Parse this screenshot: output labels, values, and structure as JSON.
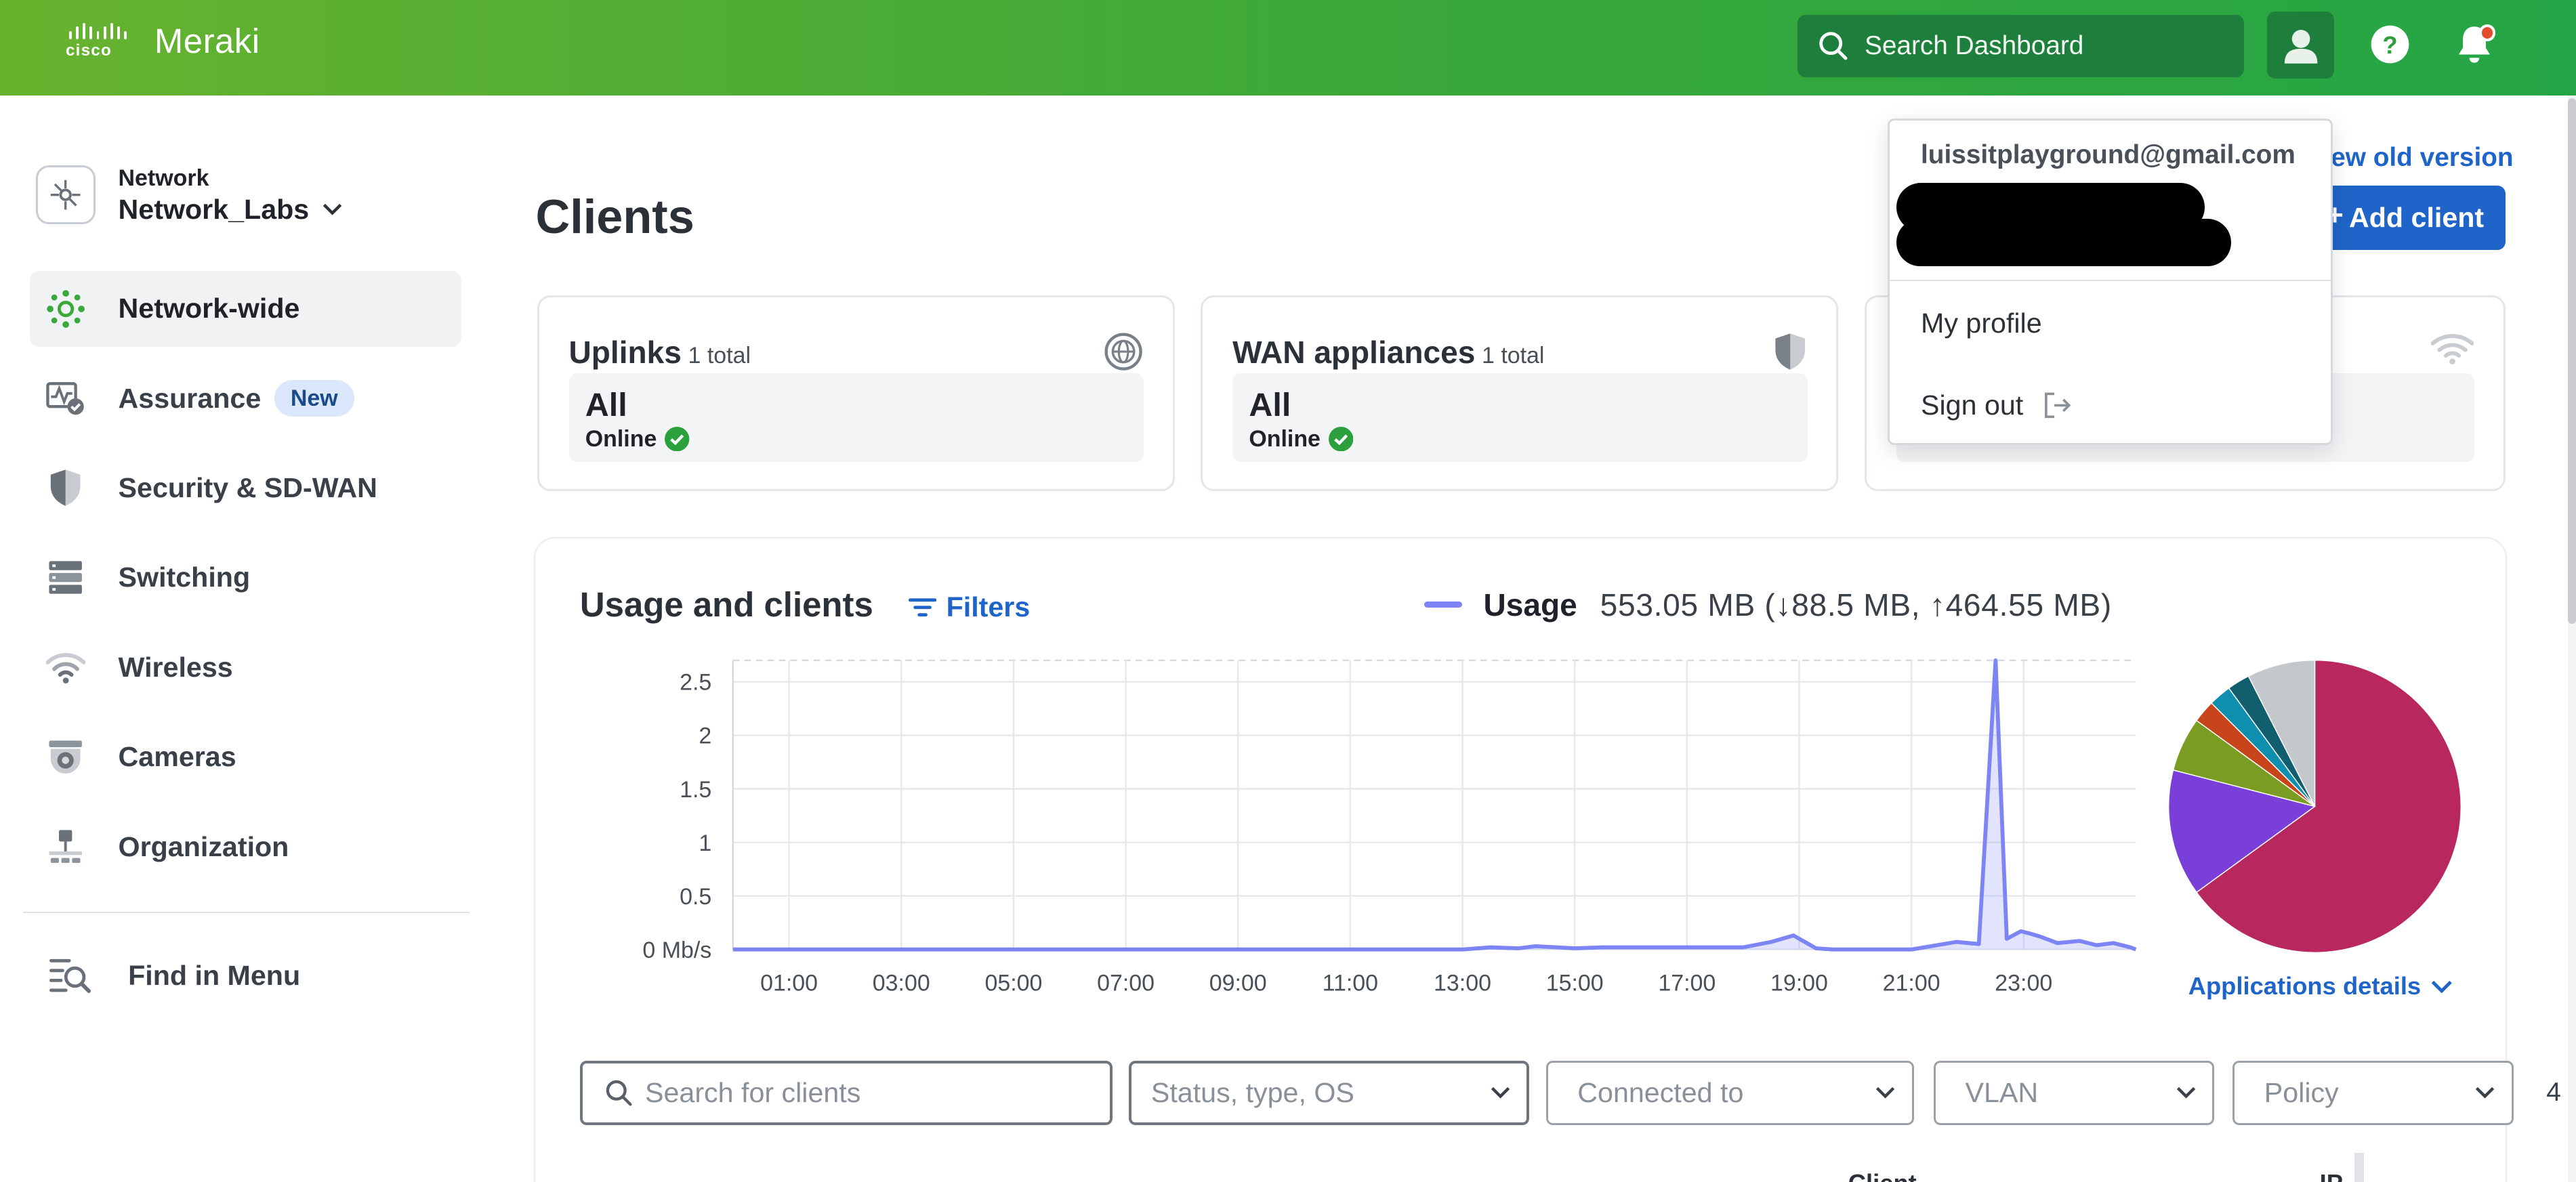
{
  "header": {
    "brand_small": "cisco",
    "brand": "Meraki",
    "search_placeholder": "Search Dashboard",
    "icons": [
      "search-icon",
      "user-icon",
      "help-icon",
      "bell-icon"
    ],
    "colors": {
      "bar_left": "#67b32e",
      "bar_right": "#24a545",
      "search_bg": "#1e7e3b",
      "notification_dot": "#e24d2e"
    }
  },
  "network": {
    "label": "Network",
    "name": "Network_Labs"
  },
  "sidebar": {
    "items": [
      {
        "label": "Network-wide",
        "icon": "network-wide-icon",
        "active": true
      },
      {
        "label": "Assurance",
        "icon": "assurance-icon",
        "badge": "New"
      },
      {
        "label": "Security & SD-WAN",
        "icon": "shield-icon"
      },
      {
        "label": "Switching",
        "icon": "switch-icon"
      },
      {
        "label": "Wireless",
        "icon": "wifi-icon"
      },
      {
        "label": "Cameras",
        "icon": "camera-icon"
      },
      {
        "label": "Organization",
        "icon": "organization-icon"
      }
    ],
    "find_menu": "Find in Menu"
  },
  "page": {
    "title": "Clients",
    "view_old": "View old version",
    "add_client": "Add client"
  },
  "cards": [
    {
      "title": "Uplinks",
      "count": "1 total",
      "value": "All",
      "status": "Online",
      "icon": "globe-icon"
    },
    {
      "title": "WAN appliances",
      "count": "1 total",
      "value": "All",
      "status": "Online",
      "icon": "shield-icon"
    },
    {
      "title": "",
      "count": "",
      "value": "",
      "status": "",
      "icon": "wifi-icon"
    }
  ],
  "usage": {
    "title": "Usage and clients",
    "filters": "Filters",
    "legend_name": "Usage",
    "legend_value": "553.05 MB (↓88.5 MB, ↑464.55 MB)",
    "applications_details": "Applications details",
    "accent": "#7d84f4",
    "link_color": "#1f64c8"
  },
  "chart_data": [
    {
      "type": "area",
      "y_unit": "Mb/s",
      "ylim": [
        0,
        2.7
      ],
      "y_ticks": [
        "0 Mb/s",
        "0.5",
        "1",
        "1.5",
        "2",
        "2.5"
      ],
      "x_ticks": [
        "01:00",
        "03:00",
        "05:00",
        "07:00",
        "09:00",
        "11:00",
        "13:00",
        "15:00",
        "17:00",
        "19:00",
        "21:00",
        "23:00"
      ],
      "xlim": [
        0.0,
        25.0
      ],
      "grid": true,
      "series": [
        {
          "name": "Usage",
          "color": "#7d84f4",
          "x": [
            0.0,
            13.0,
            13.5,
            14.0,
            14.3,
            15.0,
            15.5,
            16.0,
            17.0,
            17.5,
            18.0,
            18.5,
            18.9,
            19.3,
            19.6,
            20.0,
            21.0,
            21.8,
            22.2,
            22.5,
            22.7,
            22.95,
            23.1,
            23.3,
            23.6,
            24.0,
            24.3,
            24.6,
            24.9,
            25.0
          ],
          "values": [
            0.0,
            0.0,
            0.02,
            0.01,
            0.03,
            0.01,
            0.02,
            0.02,
            0.02,
            0.02,
            0.02,
            0.07,
            0.13,
            0.01,
            0.0,
            0.0,
            0.0,
            0.07,
            0.05,
            2.7,
            0.1,
            0.17,
            0.15,
            0.12,
            0.06,
            0.08,
            0.04,
            0.06,
            0.02,
            0.0
          ]
        }
      ]
    },
    {
      "type": "pie",
      "title": "",
      "slices": [
        {
          "value": 65.0,
          "color": "#b8285f"
        },
        {
          "value": 14.0,
          "color": "#7a3fd8"
        },
        {
          "value": 6.0,
          "color": "#7b9c22"
        },
        {
          "value": 2.5,
          "color": "#c8451c"
        },
        {
          "value": 2.5,
          "color": "#0e8fb0"
        },
        {
          "value": 2.5,
          "color": "#105e6e"
        },
        {
          "value": 7.5,
          "color": "#c4c8cc"
        }
      ]
    }
  ],
  "filters_row": {
    "search_placeholder": "Search for clients",
    "status": "Status, type, OS",
    "connected": "Connected to",
    "vlan": "VLAN",
    "policy": "Policy",
    "overflow": "4"
  },
  "table_peek": {
    "col1": "Client",
    "col2": "IP"
  },
  "profile_menu": {
    "email": "luissitplayground@gmail.com",
    "my_profile": "My profile",
    "sign_out": "Sign out"
  }
}
